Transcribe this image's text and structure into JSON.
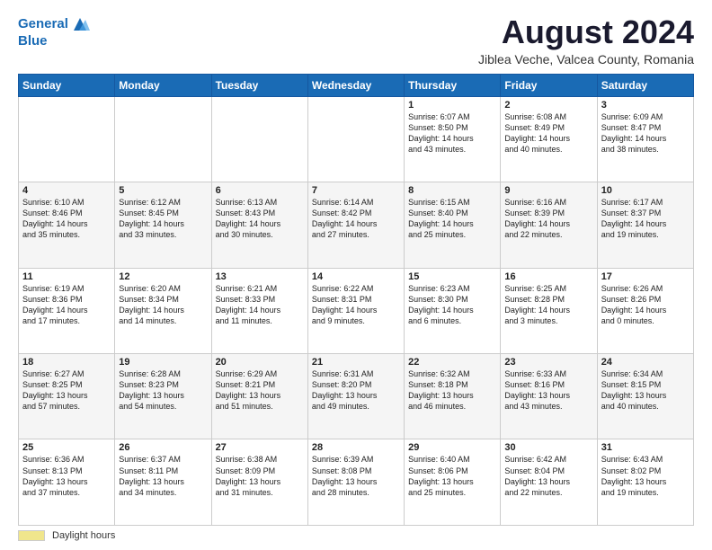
{
  "header": {
    "logo_line1": "General",
    "logo_line2": "Blue",
    "main_title": "August 2024",
    "subtitle": "Jiblea Veche, Valcea County, Romania"
  },
  "calendar": {
    "days_of_week": [
      "Sunday",
      "Monday",
      "Tuesday",
      "Wednesday",
      "Thursday",
      "Friday",
      "Saturday"
    ],
    "weeks": [
      [
        {
          "day": "",
          "info": ""
        },
        {
          "day": "",
          "info": ""
        },
        {
          "day": "",
          "info": ""
        },
        {
          "day": "",
          "info": ""
        },
        {
          "day": "1",
          "info": "Sunrise: 6:07 AM\nSunset: 8:50 PM\nDaylight: 14 hours\nand 43 minutes."
        },
        {
          "day": "2",
          "info": "Sunrise: 6:08 AM\nSunset: 8:49 PM\nDaylight: 14 hours\nand 40 minutes."
        },
        {
          "day": "3",
          "info": "Sunrise: 6:09 AM\nSunset: 8:47 PM\nDaylight: 14 hours\nand 38 minutes."
        }
      ],
      [
        {
          "day": "4",
          "info": "Sunrise: 6:10 AM\nSunset: 8:46 PM\nDaylight: 14 hours\nand 35 minutes."
        },
        {
          "day": "5",
          "info": "Sunrise: 6:12 AM\nSunset: 8:45 PM\nDaylight: 14 hours\nand 33 minutes."
        },
        {
          "day": "6",
          "info": "Sunrise: 6:13 AM\nSunset: 8:43 PM\nDaylight: 14 hours\nand 30 minutes."
        },
        {
          "day": "7",
          "info": "Sunrise: 6:14 AM\nSunset: 8:42 PM\nDaylight: 14 hours\nand 27 minutes."
        },
        {
          "day": "8",
          "info": "Sunrise: 6:15 AM\nSunset: 8:40 PM\nDaylight: 14 hours\nand 25 minutes."
        },
        {
          "day": "9",
          "info": "Sunrise: 6:16 AM\nSunset: 8:39 PM\nDaylight: 14 hours\nand 22 minutes."
        },
        {
          "day": "10",
          "info": "Sunrise: 6:17 AM\nSunset: 8:37 PM\nDaylight: 14 hours\nand 19 minutes."
        }
      ],
      [
        {
          "day": "11",
          "info": "Sunrise: 6:19 AM\nSunset: 8:36 PM\nDaylight: 14 hours\nand 17 minutes."
        },
        {
          "day": "12",
          "info": "Sunrise: 6:20 AM\nSunset: 8:34 PM\nDaylight: 14 hours\nand 14 minutes."
        },
        {
          "day": "13",
          "info": "Sunrise: 6:21 AM\nSunset: 8:33 PM\nDaylight: 14 hours\nand 11 minutes."
        },
        {
          "day": "14",
          "info": "Sunrise: 6:22 AM\nSunset: 8:31 PM\nDaylight: 14 hours\nand 9 minutes."
        },
        {
          "day": "15",
          "info": "Sunrise: 6:23 AM\nSunset: 8:30 PM\nDaylight: 14 hours\nand 6 minutes."
        },
        {
          "day": "16",
          "info": "Sunrise: 6:25 AM\nSunset: 8:28 PM\nDaylight: 14 hours\nand 3 minutes."
        },
        {
          "day": "17",
          "info": "Sunrise: 6:26 AM\nSunset: 8:26 PM\nDaylight: 14 hours\nand 0 minutes."
        }
      ],
      [
        {
          "day": "18",
          "info": "Sunrise: 6:27 AM\nSunset: 8:25 PM\nDaylight: 13 hours\nand 57 minutes."
        },
        {
          "day": "19",
          "info": "Sunrise: 6:28 AM\nSunset: 8:23 PM\nDaylight: 13 hours\nand 54 minutes."
        },
        {
          "day": "20",
          "info": "Sunrise: 6:29 AM\nSunset: 8:21 PM\nDaylight: 13 hours\nand 51 minutes."
        },
        {
          "day": "21",
          "info": "Sunrise: 6:31 AM\nSunset: 8:20 PM\nDaylight: 13 hours\nand 49 minutes."
        },
        {
          "day": "22",
          "info": "Sunrise: 6:32 AM\nSunset: 8:18 PM\nDaylight: 13 hours\nand 46 minutes."
        },
        {
          "day": "23",
          "info": "Sunrise: 6:33 AM\nSunset: 8:16 PM\nDaylight: 13 hours\nand 43 minutes."
        },
        {
          "day": "24",
          "info": "Sunrise: 6:34 AM\nSunset: 8:15 PM\nDaylight: 13 hours\nand 40 minutes."
        }
      ],
      [
        {
          "day": "25",
          "info": "Sunrise: 6:36 AM\nSunset: 8:13 PM\nDaylight: 13 hours\nand 37 minutes."
        },
        {
          "day": "26",
          "info": "Sunrise: 6:37 AM\nSunset: 8:11 PM\nDaylight: 13 hours\nand 34 minutes."
        },
        {
          "day": "27",
          "info": "Sunrise: 6:38 AM\nSunset: 8:09 PM\nDaylight: 13 hours\nand 31 minutes."
        },
        {
          "day": "28",
          "info": "Sunrise: 6:39 AM\nSunset: 8:08 PM\nDaylight: 13 hours\nand 28 minutes."
        },
        {
          "day": "29",
          "info": "Sunrise: 6:40 AM\nSunset: 8:06 PM\nDaylight: 13 hours\nand 25 minutes."
        },
        {
          "day": "30",
          "info": "Sunrise: 6:42 AM\nSunset: 8:04 PM\nDaylight: 13 hours\nand 22 minutes."
        },
        {
          "day": "31",
          "info": "Sunrise: 6:43 AM\nSunset: 8:02 PM\nDaylight: 13 hours\nand 19 minutes."
        }
      ]
    ]
  },
  "footer": {
    "daylight_label": "Daylight hours"
  }
}
